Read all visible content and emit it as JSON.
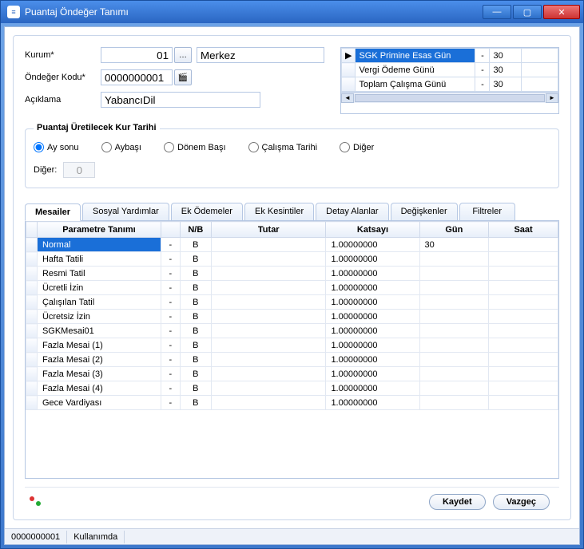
{
  "window": {
    "title": "Puantaj Öndeğer Tanımı"
  },
  "form": {
    "kurum_label": "Kurum*",
    "kurum_value": "01",
    "kurum_desc": "Merkez",
    "ondeger_label": "Öndeğer Kodu*",
    "ondeger_value": "0000000001",
    "aciklama_label": "Açıklama",
    "aciklama_value": "YabancıDil"
  },
  "side_grid": {
    "rows": [
      {
        "label": "SGK Primine Esas Gün",
        "op": "-",
        "val": "30"
      },
      {
        "label": "Vergi Ödeme Günü",
        "op": "-",
        "val": "30"
      },
      {
        "label": "Toplam Çalışma Günü",
        "op": "-",
        "val": "30"
      }
    ]
  },
  "kur_tarihi": {
    "legend": "Puantaj Üretilecek Kur Tarihi",
    "options": [
      "Ay sonu",
      "Aybaşı",
      "Dönem Başı",
      "Çalışma Tarihi",
      "Diğer"
    ],
    "selected": 0,
    "diger_label": "Diğer:",
    "diger_value": "0"
  },
  "tabs": [
    "Mesailer",
    "Sosyal Yardımlar",
    "Ek Ödemeler",
    "Ek Kesintiler",
    "Detay Alanlar",
    "Değişkenler",
    "Filtreler"
  ],
  "active_tab": 0,
  "grid": {
    "headers": [
      "",
      "Parametre Tanımı",
      "",
      "N/B",
      "Tutar",
      "Katsayı",
      "Gün",
      "Saat"
    ],
    "rows": [
      {
        "name": "Normal",
        "dash": "-",
        "nb": "B",
        "tutar": "",
        "katsayi": "1.00000000",
        "gun": "30",
        "saat": "",
        "selected": true
      },
      {
        "name": "Hafta Tatili",
        "dash": "-",
        "nb": "B",
        "tutar": "",
        "katsayi": "1.00000000",
        "gun": "",
        "saat": ""
      },
      {
        "name": "Resmi Tatil",
        "dash": "-",
        "nb": "B",
        "tutar": "",
        "katsayi": "1.00000000",
        "gun": "",
        "saat": ""
      },
      {
        "name": "Ücretli İzin",
        "dash": "-",
        "nb": "B",
        "tutar": "",
        "katsayi": "1.00000000",
        "gun": "",
        "saat": ""
      },
      {
        "name": "Çalışılan Tatil",
        "dash": "-",
        "nb": "B",
        "tutar": "",
        "katsayi": "1.00000000",
        "gun": "",
        "saat": ""
      },
      {
        "name": "Ücretsiz İzin",
        "dash": "-",
        "nb": "B",
        "tutar": "",
        "katsayi": "1.00000000",
        "gun": "",
        "saat": ""
      },
      {
        "name": "SGKMesai01",
        "dash": "-",
        "nb": "B",
        "tutar": "",
        "katsayi": "1.00000000",
        "gun": "",
        "saat": ""
      },
      {
        "name": "Fazla Mesai (1)",
        "dash": "-",
        "nb": "B",
        "tutar": "",
        "katsayi": "1.00000000",
        "gun": "",
        "saat": ""
      },
      {
        "name": "Fazla Mesai (2)",
        "dash": "-",
        "nb": "B",
        "tutar": "",
        "katsayi": "1.00000000",
        "gun": "",
        "saat": ""
      },
      {
        "name": "Fazla Mesai (3)",
        "dash": "-",
        "nb": "B",
        "tutar": "",
        "katsayi": "1.00000000",
        "gun": "",
        "saat": ""
      },
      {
        "name": "Fazla Mesai (4)",
        "dash": "-",
        "nb": "B",
        "tutar": "",
        "katsayi": "1.00000000",
        "gun": "",
        "saat": ""
      },
      {
        "name": "Gece Vardiyası",
        "dash": "-",
        "nb": "B",
        "tutar": "",
        "katsayi": "1.00000000",
        "gun": "",
        "saat": ""
      }
    ]
  },
  "footer": {
    "save": "Kaydet",
    "cancel": "Vazgeç"
  },
  "status": {
    "code": "0000000001",
    "state": "Kullanımda"
  }
}
